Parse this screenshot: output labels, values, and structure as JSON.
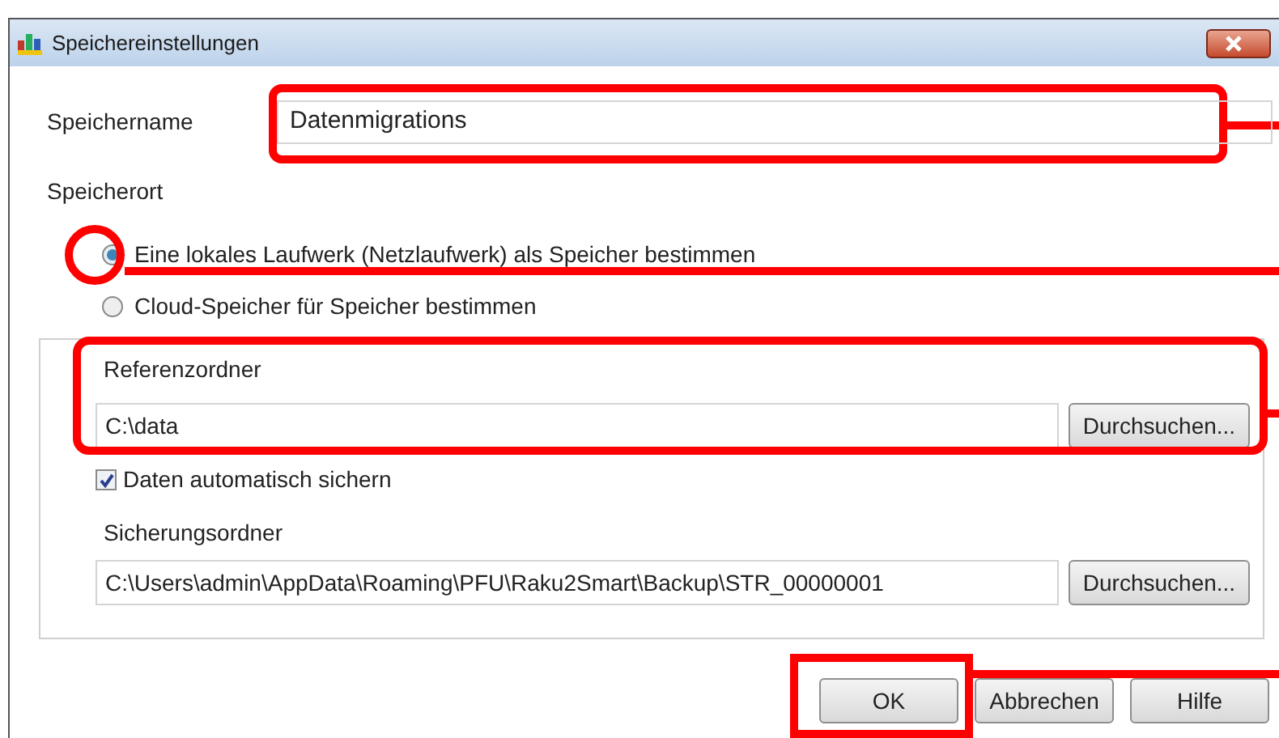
{
  "window": {
    "title": "Speichereinstellungen"
  },
  "name_field": {
    "label": "Speichername",
    "value": "Datenmigrations"
  },
  "location": {
    "label": "Speicherort",
    "options": [
      {
        "label": "Eine lokales Laufwerk (Netzlaufwerk) als Speicher bestimmen",
        "selected": true
      },
      {
        "label": "Cloud-Speicher für Speicher bestimmen",
        "selected": false
      }
    ]
  },
  "reference_folder": {
    "label": "Referenzordner",
    "value": "C:\\data",
    "browse_button": "Durchsuchen..."
  },
  "auto_backup": {
    "label": "Daten automatisch sichern",
    "checked": true
  },
  "backup_folder": {
    "label": "Sicherungsordner",
    "value": "C:\\Users\\admin\\AppData\\Roaming\\PFU\\Raku2Smart\\Backup\\STR_00000001",
    "browse_button": "Durchsuchen..."
  },
  "buttons": [
    {
      "label": "OK"
    },
    {
      "label": "Abbrechen"
    },
    {
      "label": "Hilfe"
    }
  ]
}
